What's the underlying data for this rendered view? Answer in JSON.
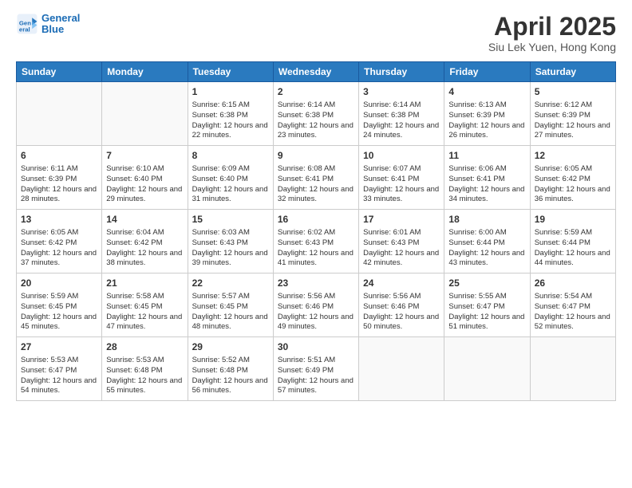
{
  "logo": {
    "line1": "General",
    "line2": "Blue"
  },
  "title": "April 2025",
  "subtitle": "Siu Lek Yuen, Hong Kong",
  "days_header": [
    "Sunday",
    "Monday",
    "Tuesday",
    "Wednesday",
    "Thursday",
    "Friday",
    "Saturday"
  ],
  "weeks": [
    [
      {
        "day": "",
        "info": ""
      },
      {
        "day": "",
        "info": ""
      },
      {
        "day": "1",
        "info": "Sunrise: 6:15 AM\nSunset: 6:38 PM\nDaylight: 12 hours and 22 minutes."
      },
      {
        "day": "2",
        "info": "Sunrise: 6:14 AM\nSunset: 6:38 PM\nDaylight: 12 hours and 23 minutes."
      },
      {
        "day": "3",
        "info": "Sunrise: 6:14 AM\nSunset: 6:38 PM\nDaylight: 12 hours and 24 minutes."
      },
      {
        "day": "4",
        "info": "Sunrise: 6:13 AM\nSunset: 6:39 PM\nDaylight: 12 hours and 26 minutes."
      },
      {
        "day": "5",
        "info": "Sunrise: 6:12 AM\nSunset: 6:39 PM\nDaylight: 12 hours and 27 minutes."
      }
    ],
    [
      {
        "day": "6",
        "info": "Sunrise: 6:11 AM\nSunset: 6:39 PM\nDaylight: 12 hours and 28 minutes."
      },
      {
        "day": "7",
        "info": "Sunrise: 6:10 AM\nSunset: 6:40 PM\nDaylight: 12 hours and 29 minutes."
      },
      {
        "day": "8",
        "info": "Sunrise: 6:09 AM\nSunset: 6:40 PM\nDaylight: 12 hours and 31 minutes."
      },
      {
        "day": "9",
        "info": "Sunrise: 6:08 AM\nSunset: 6:41 PM\nDaylight: 12 hours and 32 minutes."
      },
      {
        "day": "10",
        "info": "Sunrise: 6:07 AM\nSunset: 6:41 PM\nDaylight: 12 hours and 33 minutes."
      },
      {
        "day": "11",
        "info": "Sunrise: 6:06 AM\nSunset: 6:41 PM\nDaylight: 12 hours and 34 minutes."
      },
      {
        "day": "12",
        "info": "Sunrise: 6:05 AM\nSunset: 6:42 PM\nDaylight: 12 hours and 36 minutes."
      }
    ],
    [
      {
        "day": "13",
        "info": "Sunrise: 6:05 AM\nSunset: 6:42 PM\nDaylight: 12 hours and 37 minutes."
      },
      {
        "day": "14",
        "info": "Sunrise: 6:04 AM\nSunset: 6:42 PM\nDaylight: 12 hours and 38 minutes."
      },
      {
        "day": "15",
        "info": "Sunrise: 6:03 AM\nSunset: 6:43 PM\nDaylight: 12 hours and 39 minutes."
      },
      {
        "day": "16",
        "info": "Sunrise: 6:02 AM\nSunset: 6:43 PM\nDaylight: 12 hours and 41 minutes."
      },
      {
        "day": "17",
        "info": "Sunrise: 6:01 AM\nSunset: 6:43 PM\nDaylight: 12 hours and 42 minutes."
      },
      {
        "day": "18",
        "info": "Sunrise: 6:00 AM\nSunset: 6:44 PM\nDaylight: 12 hours and 43 minutes."
      },
      {
        "day": "19",
        "info": "Sunrise: 5:59 AM\nSunset: 6:44 PM\nDaylight: 12 hours and 44 minutes."
      }
    ],
    [
      {
        "day": "20",
        "info": "Sunrise: 5:59 AM\nSunset: 6:45 PM\nDaylight: 12 hours and 45 minutes."
      },
      {
        "day": "21",
        "info": "Sunrise: 5:58 AM\nSunset: 6:45 PM\nDaylight: 12 hours and 47 minutes."
      },
      {
        "day": "22",
        "info": "Sunrise: 5:57 AM\nSunset: 6:45 PM\nDaylight: 12 hours and 48 minutes."
      },
      {
        "day": "23",
        "info": "Sunrise: 5:56 AM\nSunset: 6:46 PM\nDaylight: 12 hours and 49 minutes."
      },
      {
        "day": "24",
        "info": "Sunrise: 5:56 AM\nSunset: 6:46 PM\nDaylight: 12 hours and 50 minutes."
      },
      {
        "day": "25",
        "info": "Sunrise: 5:55 AM\nSunset: 6:47 PM\nDaylight: 12 hours and 51 minutes."
      },
      {
        "day": "26",
        "info": "Sunrise: 5:54 AM\nSunset: 6:47 PM\nDaylight: 12 hours and 52 minutes."
      }
    ],
    [
      {
        "day": "27",
        "info": "Sunrise: 5:53 AM\nSunset: 6:47 PM\nDaylight: 12 hours and 54 minutes."
      },
      {
        "day": "28",
        "info": "Sunrise: 5:53 AM\nSunset: 6:48 PM\nDaylight: 12 hours and 55 minutes."
      },
      {
        "day": "29",
        "info": "Sunrise: 5:52 AM\nSunset: 6:48 PM\nDaylight: 12 hours and 56 minutes."
      },
      {
        "day": "30",
        "info": "Sunrise: 5:51 AM\nSunset: 6:49 PM\nDaylight: 12 hours and 57 minutes."
      },
      {
        "day": "",
        "info": ""
      },
      {
        "day": "",
        "info": ""
      },
      {
        "day": "",
        "info": ""
      }
    ]
  ]
}
